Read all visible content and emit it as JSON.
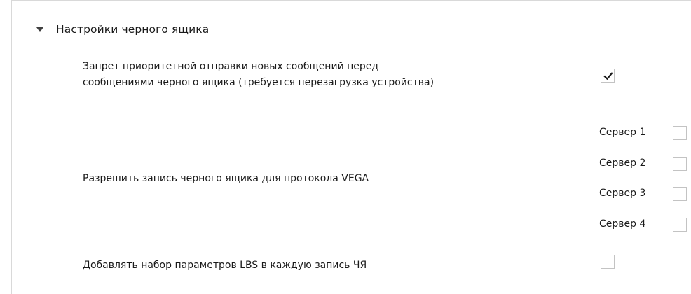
{
  "section": {
    "title": "Настройки черного ящика",
    "expanded": true,
    "icon": "triangle-down-icon"
  },
  "rows": {
    "priority": {
      "line1": "Запрет приоритетной отправки новых сообщений перед",
      "line2": "сообщениями черного ящика (требуется перезагрузка устройства)",
      "checked": true
    },
    "vega": {
      "label": "Разрешить запись черного ящика для протокола VEGA",
      "servers": [
        {
          "label": "Сервер 1",
          "checked": false
        },
        {
          "label": "Сервер 2",
          "checked": false
        },
        {
          "label": "Сервер 3",
          "checked": false
        },
        {
          "label": "Сервер 4",
          "checked": false
        }
      ]
    },
    "lbs": {
      "label": "Добавлять набор параметров LBS в каждую запись ЧЯ",
      "checked": false
    }
  },
  "colors": {
    "checkbox_border": "#c3c3c3",
    "checkmark": "#1a1a1a",
    "panel_border": "#d9d9d9"
  }
}
